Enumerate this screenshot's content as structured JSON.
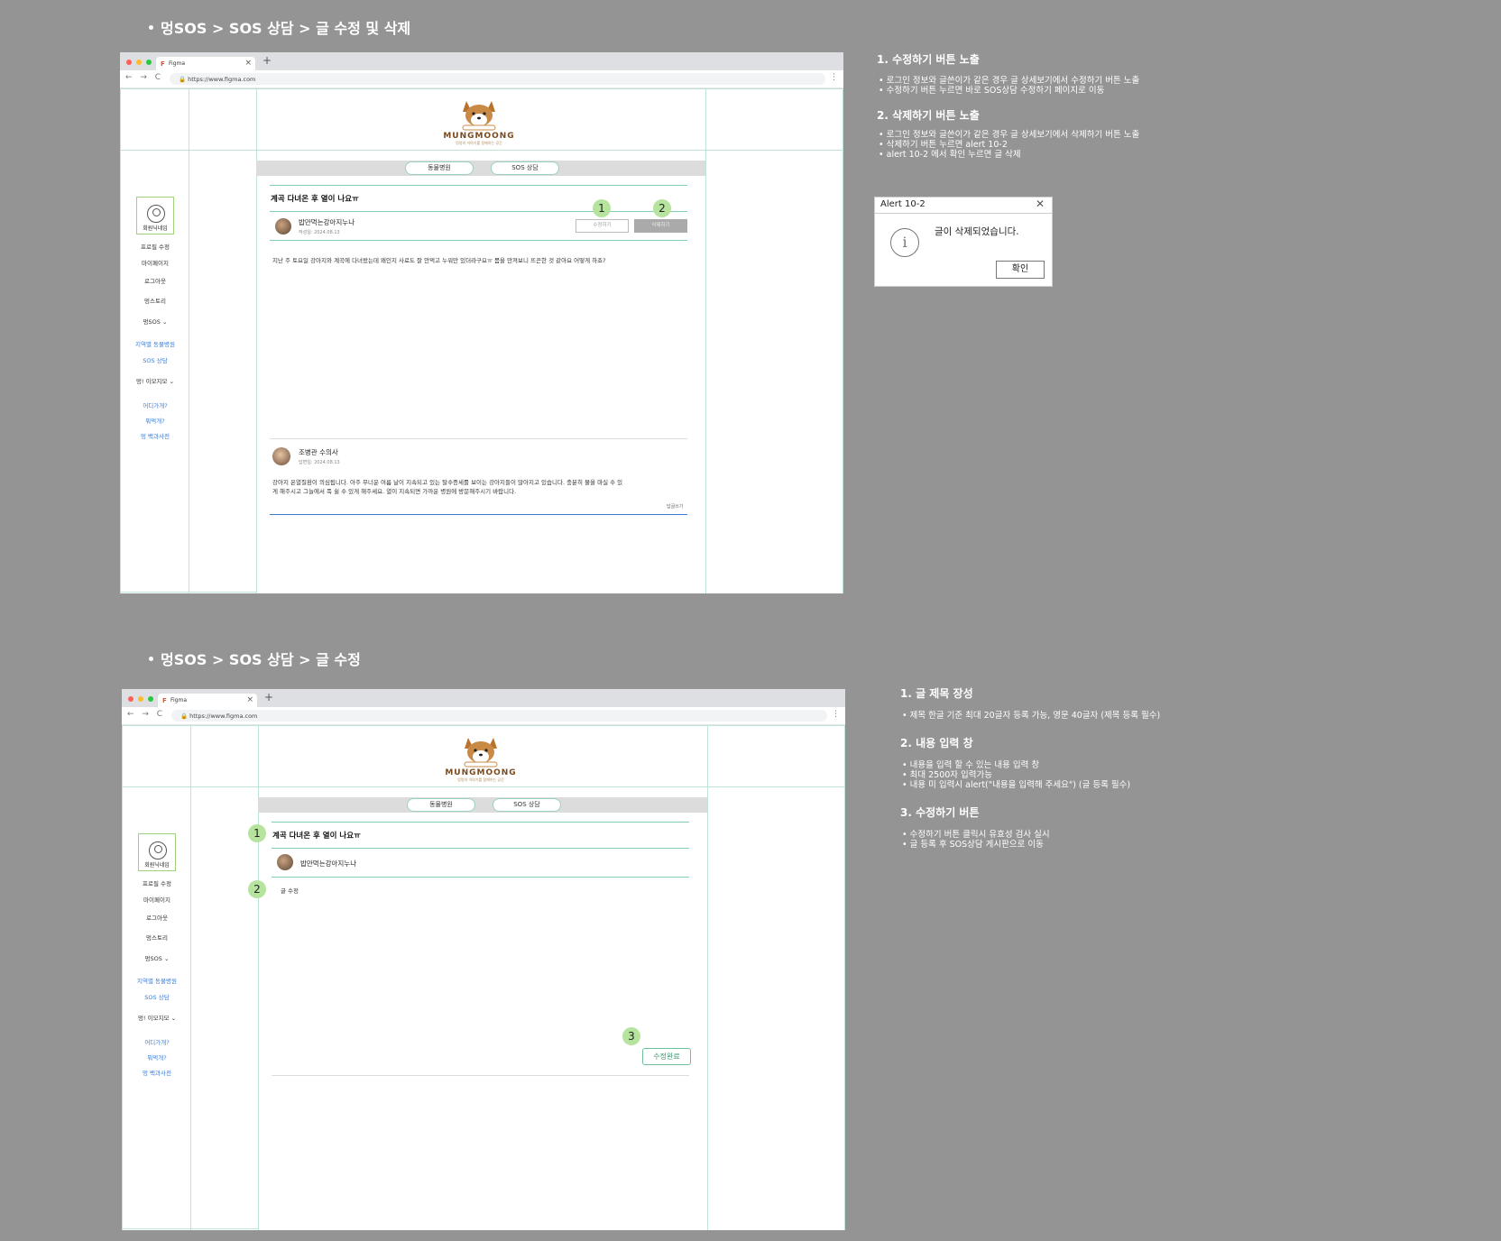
{
  "section1": {
    "title": "멍SOS > SOS 상담 > 글 수정 및 삭제",
    "browser": {
      "tab_title": "Figma",
      "url": "https://www.figma.com"
    },
    "logo": {
      "text": "MUNGMOONG",
      "sub": "멍멍의 이야기를 함께하는 공간"
    },
    "categories": [
      "동물병원",
      "SOS 상담"
    ],
    "sidebar": {
      "avatar_label": "회원닉네임",
      "items": [
        "프로필 수정",
        "마이페이지",
        "로그아웃",
        "멍스토리",
        "멍SOS ⌄"
      ],
      "sos_links": [
        "지역별 동물병원",
        "SOS 상담"
      ],
      "emoji_group": "멍! 이모지모 ⌄",
      "emoji_links": [
        "어디가개?",
        "뭐먹개?",
        "멍 백과사전"
      ]
    },
    "post": {
      "title": "계곡 다녀온 후 열이 나요ㅠ",
      "author": "밥만먹는강아지누나",
      "date": "작성일: 2024.08.13",
      "edit_label": "수정하기",
      "delete_label": "삭제하기",
      "content": "지난 주 토요일 강아지와 계곡에 다녀왔는데 왜인지 사료도 잘 안먹고 누워만 있더라구요ㅠ 몸을 만져보니 뜨끈한 것 같아요 어떻게 하죠?"
    },
    "badges": [
      "1",
      "2"
    ],
    "answer": {
      "author": "조병관 수의사",
      "date": "답변일: 2024.08.13",
      "content_line1": "강아지 온열질환이 의심됩니다. 아주 무너운 여름 날이 지속되고 있는 탈수증세를 보이는 강아지들이 많아지고 있습니다. 충분히 물을 마실 수 있",
      "content_line2": "게 해주시고 그늘에서 푹 쉴 수 있게 해주세요. 열이 지속되면 가까운 병원에 방문해주시기 바랍니다.",
      "reply_label": "답글쓰기"
    },
    "notes": [
      {
        "heading": "1. 수정하기 버튼 노출",
        "lines": [
          "• 로그인 정보와 글쓴이가 같은 경우 글 상세보기에서 수정하기 버튼 노출",
          "• 수정하기 버튼 누르면 바로 SOS상담 수정하기 페이지로 이동"
        ]
      },
      {
        "heading": "2. 삭제하기 버튼 노출",
        "lines": [
          "• 로그인 정보와 글쓴이가 같은 경우 글 상세보기에서 삭제하기 버튼 노출",
          "• 삭제하기 버튼 누르면 alert 10-2",
          "• alert 10-2 에서 확인 누르면 글 삭제"
        ]
      }
    ],
    "alert": {
      "title": "Alert 10-2",
      "message": "글이 삭제되었습니다.",
      "ok_label": "확인",
      "info_glyph": "i"
    }
  },
  "section2": {
    "title": "멍SOS > SOS 상담 > 글 수정",
    "browser": {
      "tab_title": "Figma",
      "url": "https://www.figma.com"
    },
    "logo": {
      "text": "MUNGMOONG",
      "sub": "멍멍의 이야기를 함께하는 공간"
    },
    "categories": [
      "동물병원",
      "SOS 상담"
    ],
    "sidebar": {
      "avatar_label": "회원닉네임",
      "items": [
        "프로필 수정",
        "마이페이지",
        "로그아웃",
        "멍스토리",
        "멍SOS ⌄"
      ],
      "sos_links": [
        "지역별 동물병원",
        "SOS 상담"
      ],
      "emoji_group": "멍! 이모지모 ⌄",
      "emoji_links": [
        "어디가개?",
        "뭐먹개?",
        "멍 백과사전"
      ]
    },
    "form": {
      "title_value": "계곡 다녀온 후 열이 나요ㅠ",
      "author": "밥만먹는강아지누나",
      "content_value": "글 수정",
      "submit_label": "수정완료"
    },
    "badges": [
      "1",
      "2",
      "3"
    ],
    "notes": [
      {
        "heading": "1. 글 제목 장성",
        "lines": [
          "• 제목 한글 기준 최대 20글자 등록 가능, 영문 40글자 (제목 등록 필수)"
        ]
      },
      {
        "heading": "2. 내용 입력 창",
        "lines": [
          "• 내용을 입력 할 수 있는 내용 입력 창",
          "• 최대 2500자 입력가능",
          "• 내용 미 입력시 alert(\"내용을 입력해 주세요\") (글 등록 필수)"
        ]
      },
      {
        "heading": "3. 수정하기 버튼",
        "lines": [
          "• 수정하기 버튼 클릭시 유효성 검사 실시",
          "• 글 등록 후 SOS상담 게시판으로 이동"
        ]
      }
    ]
  },
  "colors": {
    "background": "#949494",
    "accent_green": "#7ecfae",
    "badge": "#b6e39e",
    "link": "#3a7bd5"
  }
}
